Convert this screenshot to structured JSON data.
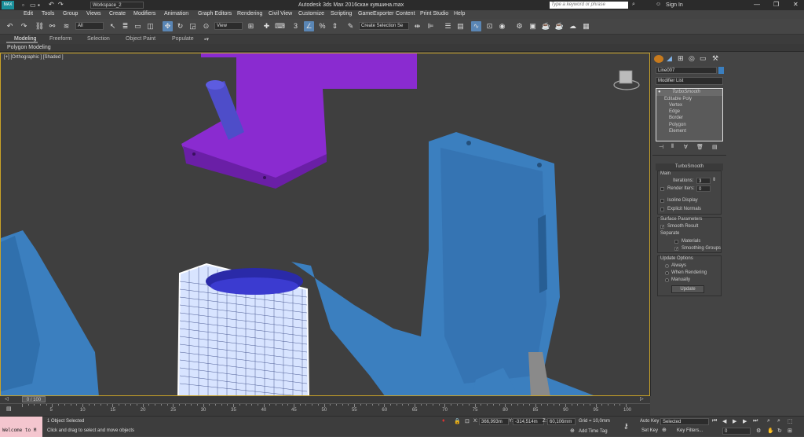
{
  "titlebar": {
    "workspace": "Workspace_2",
    "app_title": "Autodesk 3ds Max 2016",
    "file_name": "скан кувшина.max",
    "search_placeholder": "Type a keyword or phrase",
    "sign_in": "Sign In"
  },
  "menu": [
    "Edit",
    "Tools",
    "Group",
    "Views",
    "Create",
    "Modifiers",
    "Animation",
    "Graph Editors",
    "Rendering",
    "Civil View",
    "Customize",
    "Scripting",
    "GameExporter",
    "Content",
    "Print Studio",
    "Help"
  ],
  "toolbar": {
    "filter_value": "All",
    "ref_coord_value": "View",
    "selection_set_placeholder": "Create Selection Se"
  },
  "ribbon": {
    "tabs": [
      "Modeling",
      "Freeform",
      "Selection",
      "Object Paint",
      "Populate"
    ],
    "sub_label": "Polygon Modeling"
  },
  "viewport": {
    "label": "[+] [Orthographic ] [Shaded ]"
  },
  "command_panel": {
    "object_name": "Line007",
    "modifier_list": "Modifier List",
    "stack": [
      "TurboSmooth",
      "Editable Poly",
      "Vertex",
      "Edge",
      "Border",
      "Polygon",
      "Element"
    ],
    "rollout_title": "TurboSmooth",
    "main_label": "Main",
    "iterations_label": "Iterations:",
    "iterations_value": "3",
    "render_iters_label": "Render Iters:",
    "render_iters_value": "0",
    "isoline_label": "Isoline Display",
    "explicit_normals_label": "Explicit Normals",
    "surface_params_label": "Surface Parameters",
    "smooth_result_label": "Smooth Result",
    "separate_label": "Separate",
    "materials_label": "Materials",
    "smoothing_groups_label": "Smoothing Groups",
    "update_options_label": "Update Options",
    "always_label": "Always",
    "when_rendering_label": "When Rendering",
    "manually_label": "Manually",
    "update_button": "Update"
  },
  "timeline": {
    "frame_counter": "0 / 100",
    "ticks": [
      "5",
      "10",
      "15",
      "20",
      "25",
      "30",
      "35",
      "40",
      "45",
      "50",
      "55",
      "60",
      "65",
      "70",
      "75",
      "80",
      "85",
      "90",
      "95",
      "100"
    ]
  },
  "status": {
    "listener": "Welcome to M",
    "selected": "1 Object Selected",
    "prompt": "Click and drag to select and move objects",
    "x_label": "X:",
    "x_value": "366,993m",
    "y_label": "Y:",
    "y_value": "-314,514m",
    "z_label": "Z:",
    "z_value": "60,106mm",
    "grid": "Grid = 10,0mm",
    "add_time_tag": "Add Time Tag",
    "auto_key": "Auto Key",
    "set_key": "Set Key",
    "selected_dropdown": "Selected",
    "key_filters": "Key Filters...",
    "frame_field": "0"
  },
  "colors": {
    "accent_blue": "#5a86b5",
    "viewport_border": "#c9a227",
    "purple_object": "#8a2bd0",
    "blue_object": "#3b7fbf"
  }
}
